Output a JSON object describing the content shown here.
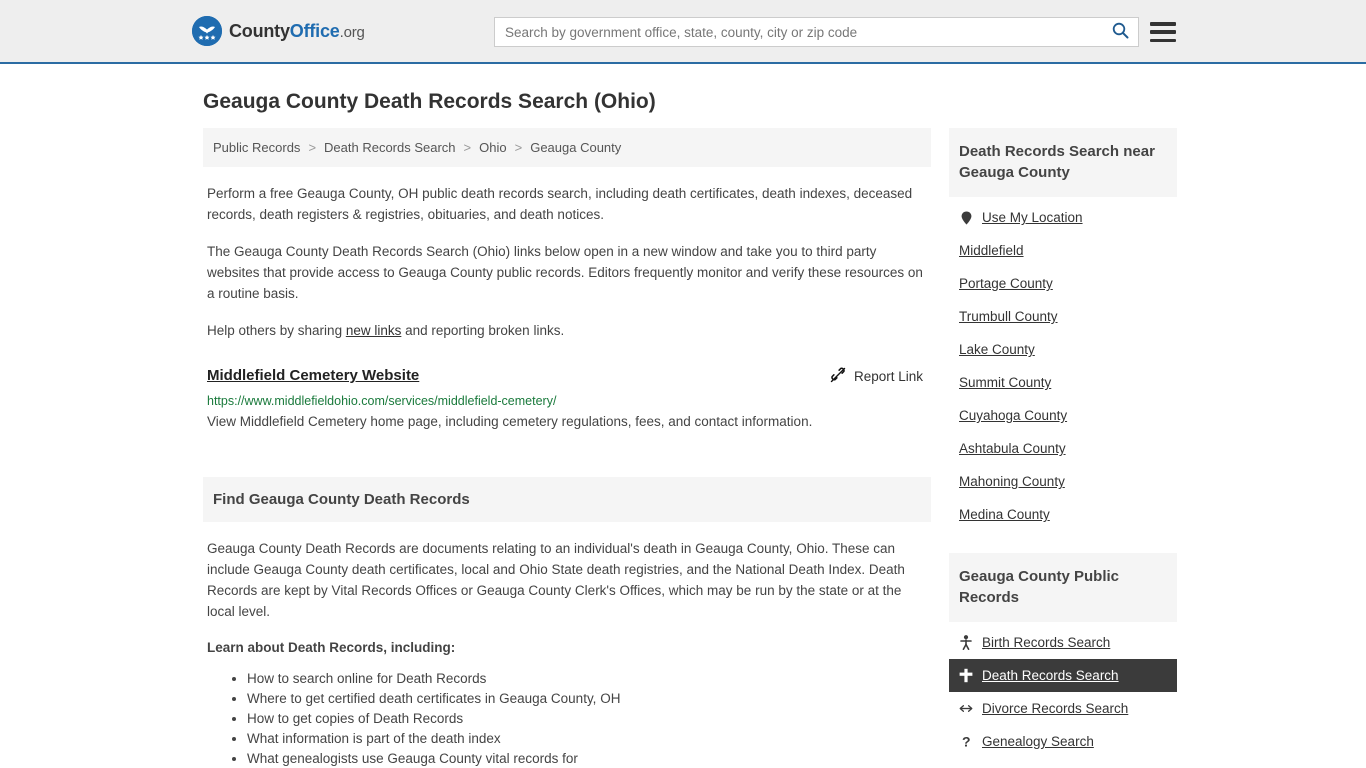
{
  "header": {
    "brand": {
      "part1": "County",
      "part2": "Office",
      "part3": ".org",
      "logo_icon": "eagle-stars-logo-icon"
    },
    "search": {
      "placeholder": "Search by government office, state, county, city or zip code",
      "value": "",
      "icon": "search-icon"
    },
    "menu_icon": "hamburger-menu-icon",
    "accent_color": "#2b6ca3"
  },
  "page": {
    "title": "Geauga County Death Records Search (Ohio)"
  },
  "breadcrumb": {
    "items": [
      "Public Records",
      "Death Records Search",
      "Ohio",
      "Geauga County"
    ],
    "separator": ">"
  },
  "intro": {
    "p1": "Perform a free Geauga County, OH public death records search, including death certificates, death indexes, deceased records, death registers & registries, obituaries, and death notices.",
    "p2": "The Geauga County Death Records Search (Ohio) links below open in a new window and take you to third party websites that provide access to Geauga County public records. Editors frequently monitor and verify these resources on a routine basis.",
    "p3_before": "Help others by sharing ",
    "p3_link": "new links",
    "p3_after": " and reporting broken links."
  },
  "result": {
    "title": "Middlefield Cemetery Website",
    "url": "https://www.middlefieldohio.com/services/middlefield-cemetery/",
    "description": "View Middlefield Cemetery home page, including cemetery regulations, fees, and contact information.",
    "report_label": "Report Link",
    "report_icon": "broken-link-icon",
    "url_color": "#1a7a3c"
  },
  "find_section": {
    "heading": "Find Geauga County Death Records",
    "paragraph": "Geauga County Death Records are documents relating to an individual's death in Geauga County, Ohio. These can include Geauga County death certificates, local and Ohio State death registries, and the National Death Index. Death Records are kept by Vital Records Offices or Geauga County Clerk's Offices, which may be run by the state or at the local level.",
    "learn_heading": "Learn about Death Records, including:",
    "bullets": [
      "How to search online for Death Records",
      "Where to get certified death certificates in Geauga County, OH",
      "How to get copies of Death Records",
      "What information is part of the death index",
      "What genealogists use Geauga County vital records for"
    ]
  },
  "sidebar": {
    "nearby": {
      "heading": "Death Records Search near Geauga County",
      "items": [
        {
          "label": "Use My Location",
          "icon": "map-pin-icon"
        },
        {
          "label": "Middlefield",
          "icon": ""
        },
        {
          "label": "Portage County",
          "icon": ""
        },
        {
          "label": "Trumbull County",
          "icon": ""
        },
        {
          "label": "Lake County",
          "icon": ""
        },
        {
          "label": "Summit County",
          "icon": ""
        },
        {
          "label": "Cuyahoga County",
          "icon": ""
        },
        {
          "label": "Ashtabula County",
          "icon": ""
        },
        {
          "label": "Mahoning County",
          "icon": ""
        },
        {
          "label": "Medina County",
          "icon": ""
        }
      ]
    },
    "public_records": {
      "heading": "Geauga County Public Records",
      "active_bg": "#3b3b3b",
      "items": [
        {
          "label": "Birth Records Search",
          "icon": "baby-icon",
          "active": false
        },
        {
          "label": "Death Records Search",
          "icon": "cross-icon",
          "active": true
        },
        {
          "label": "Divorce Records Search",
          "icon": "double-arrow-icon",
          "active": false
        },
        {
          "label": "Genealogy Search",
          "icon": "question-mark-icon",
          "active": false
        }
      ]
    }
  }
}
